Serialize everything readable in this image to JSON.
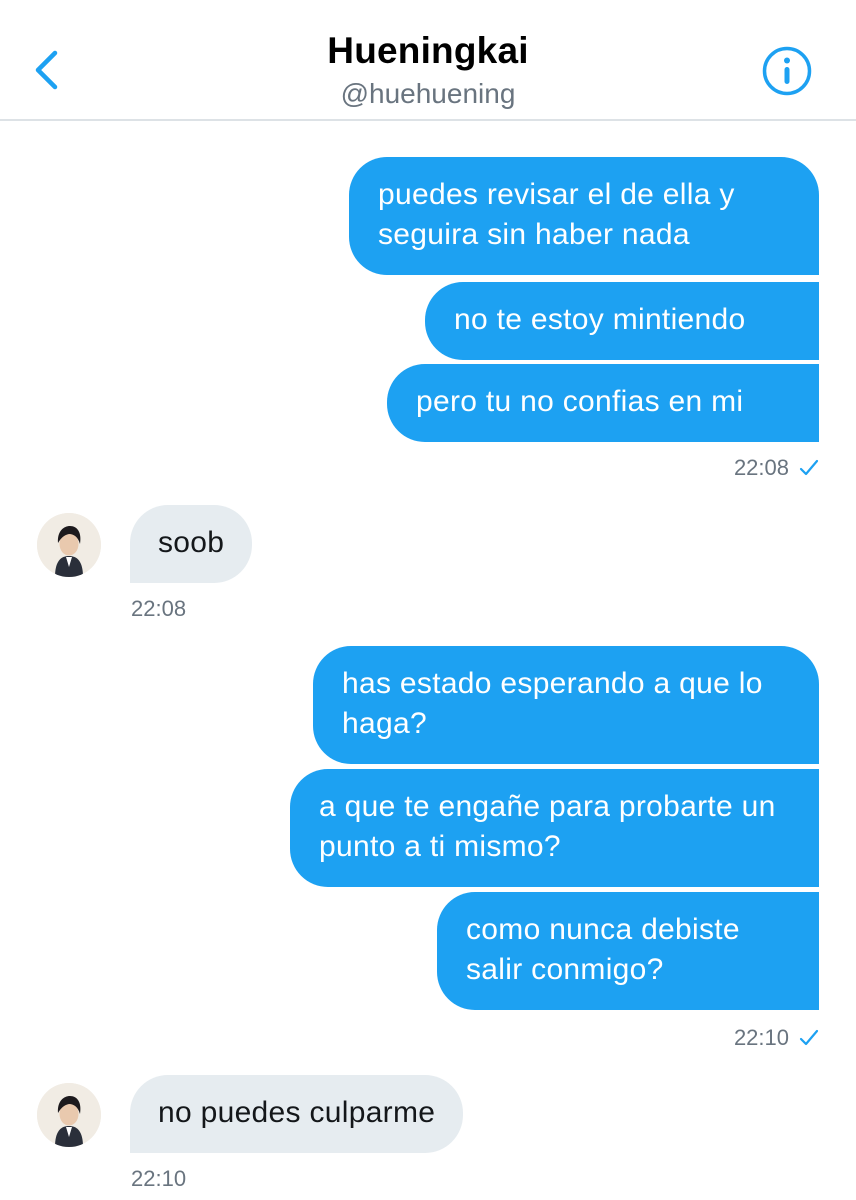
{
  "header": {
    "title": "Hueningkai",
    "handle": "@huehuening",
    "back_icon": "chevron-left-icon",
    "info_icon": "info-circle-icon",
    "accent_color": "#1da1f2"
  },
  "messages": [
    {
      "direction": "sent",
      "text": "puedes revisar el de ella y seguira sin haber nada"
    },
    {
      "direction": "sent",
      "text": "no te estoy mintiendo"
    },
    {
      "direction": "sent",
      "text": "pero tu no confias en mi"
    },
    {
      "direction": "sent_time",
      "text": "22:08"
    },
    {
      "direction": "received",
      "text": "soob"
    },
    {
      "direction": "received_time",
      "text": "22:08"
    },
    {
      "direction": "sent",
      "text": "has estado esperando a que lo haga?"
    },
    {
      "direction": "sent",
      "text": "a que te engañe para probarte un punto a ti mismo?"
    },
    {
      "direction": "sent",
      "text": "como nunca debiste salir conmigo?"
    },
    {
      "direction": "sent_time",
      "text": "22:10"
    },
    {
      "direction": "received",
      "text": "no puedes culparme"
    },
    {
      "direction": "received_time",
      "text": "22:10"
    }
  ],
  "colors": {
    "sent_bubble": "#1da1f2",
    "received_bubble": "#e6ecf0",
    "timestamp": "#69747f"
  }
}
